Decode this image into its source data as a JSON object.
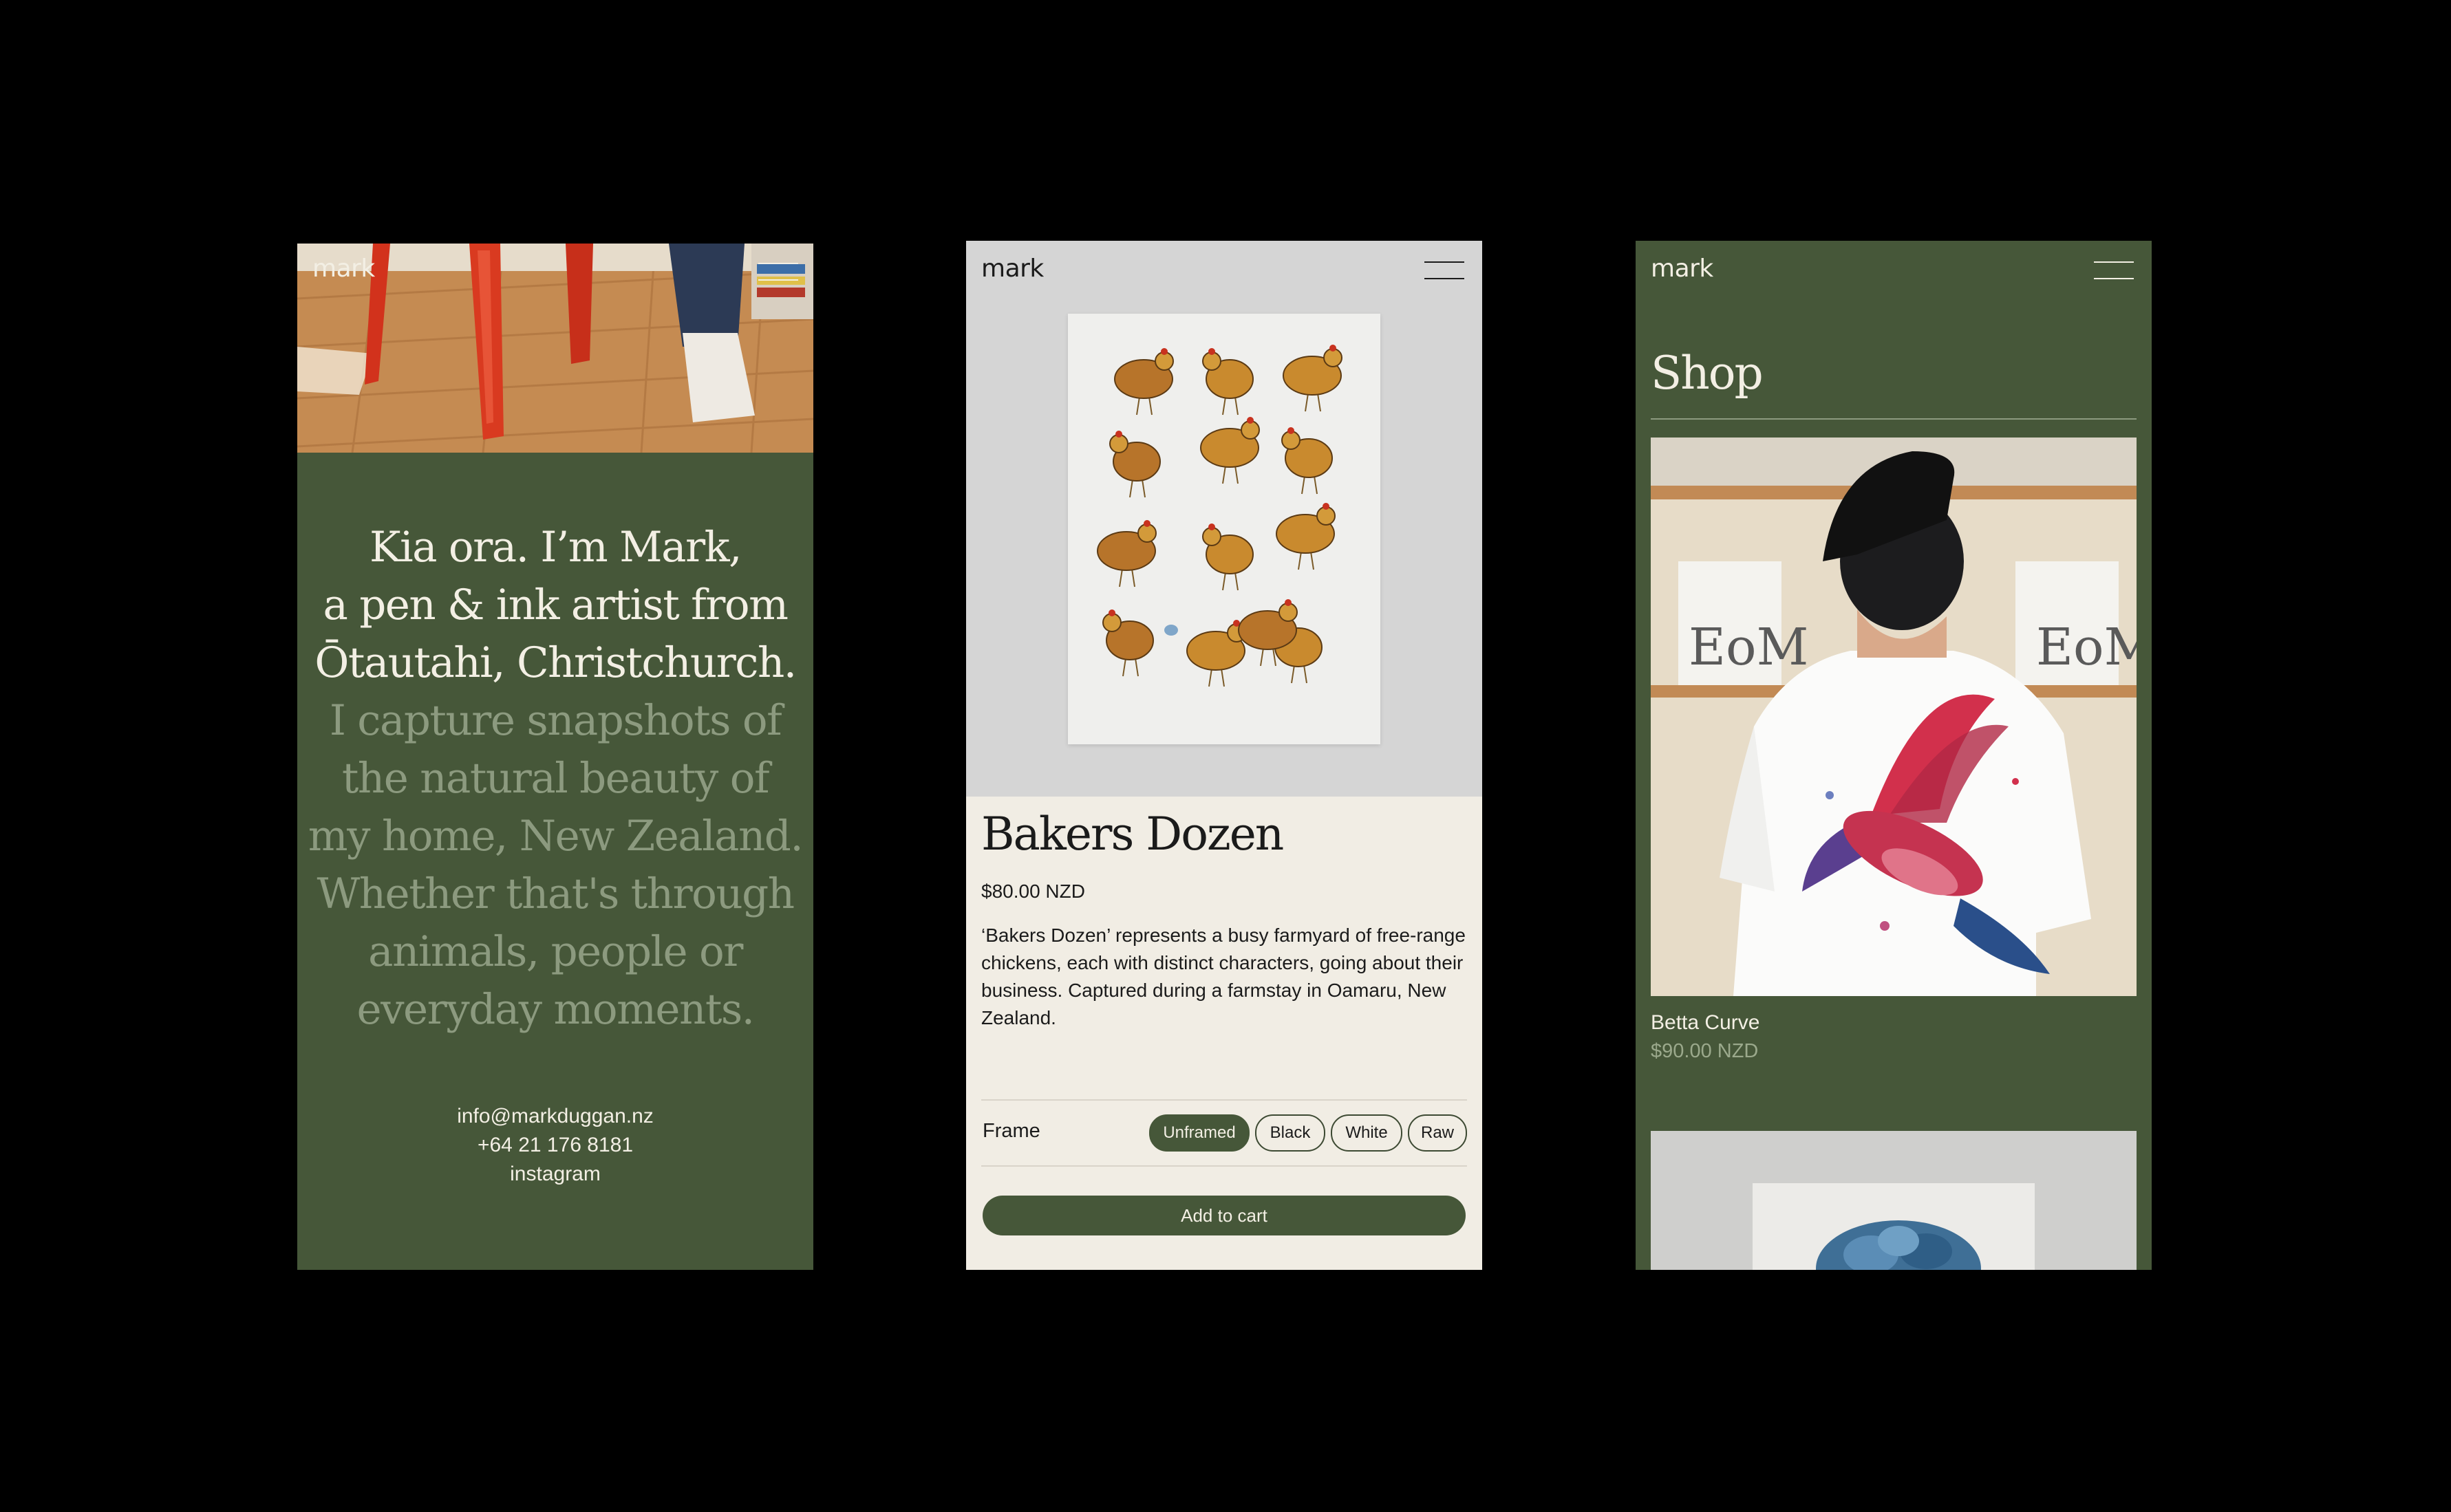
{
  "colors": {
    "green": "#465739",
    "cream": "#f1ede4",
    "ink": "#1b1b1b",
    "dim_text": "#8c9a7f"
  },
  "brand": {
    "logo": "mark"
  },
  "about": {
    "intro_lines": [
      "Kia ora. I’m Mark,",
      "a pen & ink artist from",
      "Ōtautahi, Christchurch."
    ],
    "body_lines": [
      "I capture snapshots of",
      "the natural beauty of",
      "my home, New Zealand.",
      "Whether that's through",
      "animals, people or",
      "everyday moments."
    ],
    "contact": {
      "email": "info@markduggan.nz",
      "phone": "+64 21 176 8181",
      "social": "instagram"
    }
  },
  "product": {
    "title": "Bakers Dozen",
    "price": "$80.00 NZD",
    "description": "‘Bakers Dozen’ represents a busy farmyard of free-range chickens, each with distinct characters, going about their business. Captured during a farmstay in Oamaru, New Zealand.",
    "frame_label": "Frame",
    "frame_options": [
      "Unframed",
      "Black",
      "White",
      "Raw"
    ],
    "selected_frame": "Unframed",
    "add_to_cart": "Add to cart"
  },
  "shop": {
    "title": "Shop",
    "items": [
      {
        "name": "Betta Curve",
        "price": "$90.00 NZD"
      }
    ],
    "image_text": [
      "EoM",
      "EoM"
    ]
  }
}
